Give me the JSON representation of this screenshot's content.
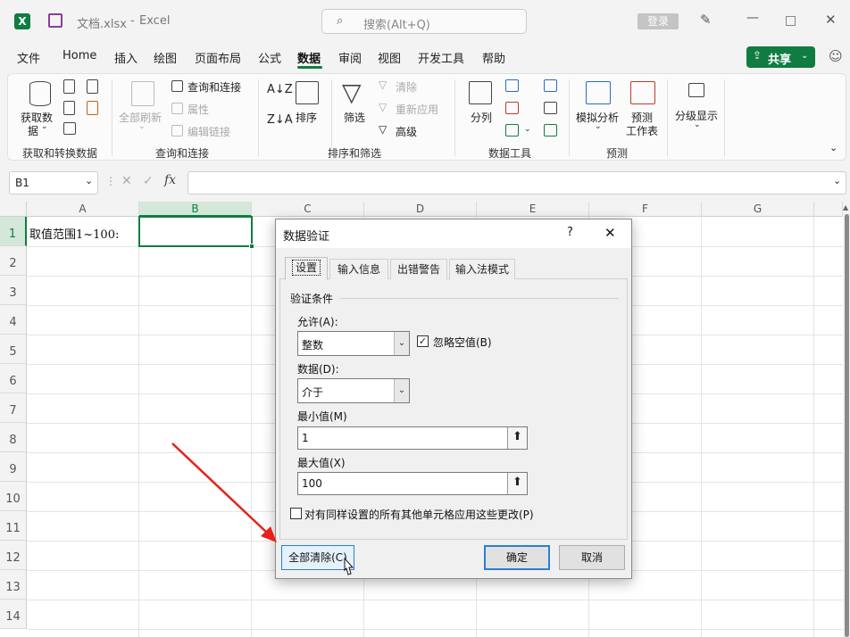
{
  "titlebar": {
    "filename": "文档.xlsx",
    "separator": "-",
    "app": "Excel",
    "search_placeholder": "搜索(Alt+Q)",
    "login": "登录"
  },
  "menu": {
    "items": [
      "文件",
      "Home",
      "插入",
      "绘图",
      "页面布局",
      "公式",
      "数据",
      "审阅",
      "视图",
      "开发工具",
      "帮助"
    ],
    "active": "数据",
    "share": "共享"
  },
  "ribbon": {
    "get_data": {
      "label_line1": "获取数",
      "label_line2": "据"
    },
    "group_get": "获取和转换数据",
    "refresh_all": "全部刷新",
    "query_connect": "查询和连接",
    "properties": "属性",
    "edit_links": "编辑链接",
    "group_query": "查询和连接",
    "sort": "排序",
    "filter": "筛选",
    "clear": "清除",
    "reapply": "重新应用",
    "advanced": "高级",
    "group_sort": "排序和筛选",
    "split": "分列",
    "group_tools": "数据工具",
    "whatif": "模拟分析",
    "forecast_line1": "预测",
    "forecast_line2": "工作表",
    "group_forecast": "预测",
    "outline": "分级显示"
  },
  "formula_bar": {
    "name_box": "B1",
    "fx": "fx",
    "value": ""
  },
  "columns": [
    "A",
    "B",
    "C",
    "D",
    "E",
    "F",
    "G"
  ],
  "rows": [
    "1",
    "2",
    "3",
    "4",
    "5",
    "6",
    "7",
    "8",
    "9",
    "10",
    "11",
    "12",
    "13",
    "14"
  ],
  "cells": {
    "A1": "取值范围1~100:"
  },
  "dialog": {
    "title": "数据验证",
    "help": "?",
    "close": "✕",
    "tabs": [
      "设置",
      "输入信息",
      "出错警告",
      "输入法模式"
    ],
    "section": "验证条件",
    "allow_label": "允许(A):",
    "allow_value": "整数",
    "ignore_blank": "忽略空值(B)",
    "ignore_blank_checked": true,
    "data_label": "数据(D):",
    "data_value": "介于",
    "min_label": "最小值(M)",
    "min_value": "1",
    "max_label": "最大值(X)",
    "max_value": "100",
    "apply_all": "对有同样设置的所有其他单元格应用这些更改(P)",
    "clear_all": "全部清除(C)",
    "ok": "确定",
    "cancel": "取消"
  },
  "colors": {
    "accent": "#107c41",
    "arrow": "#e8201a"
  }
}
